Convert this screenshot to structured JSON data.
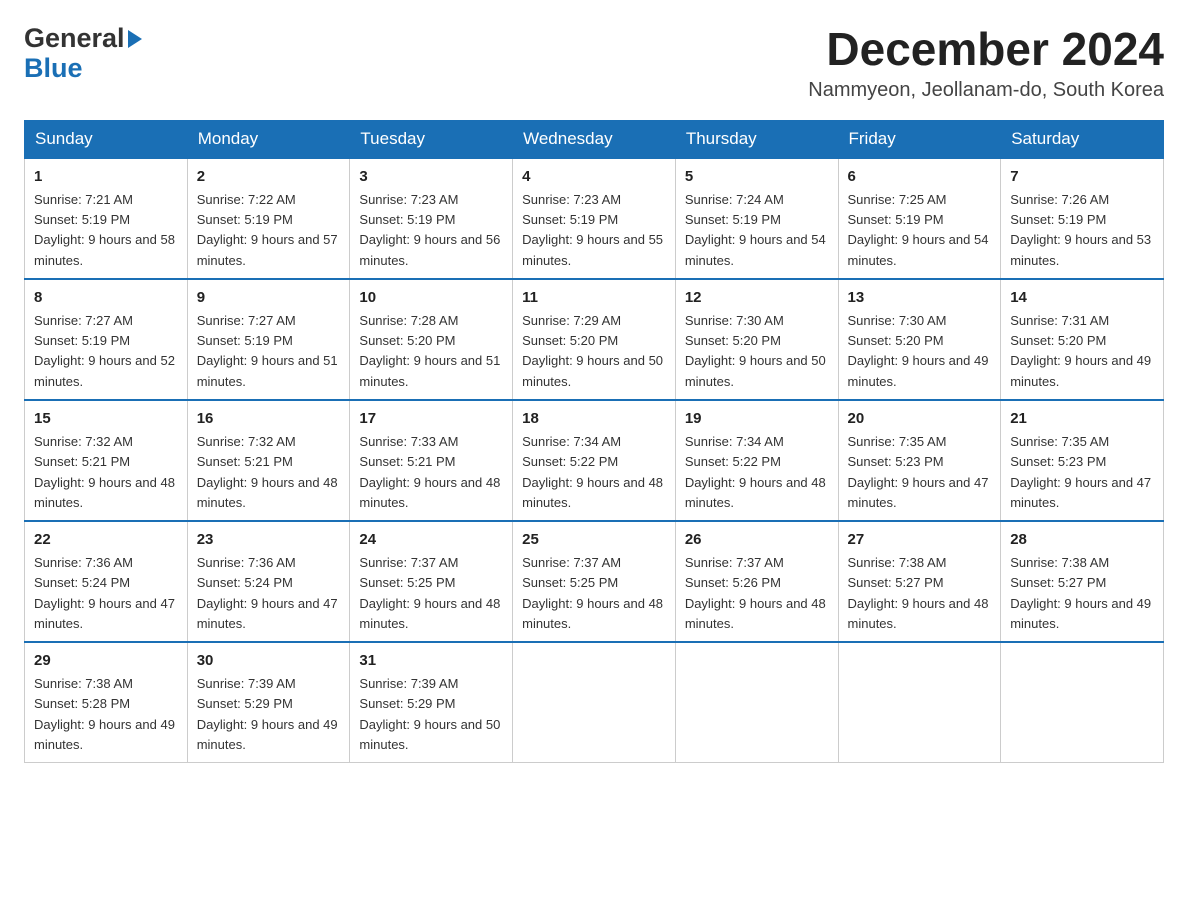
{
  "header": {
    "logo_general": "General",
    "logo_blue": "Blue",
    "title": "December 2024",
    "subtitle": "Nammyeon, Jeollanam-do, South Korea"
  },
  "calendar": {
    "days_of_week": [
      "Sunday",
      "Monday",
      "Tuesday",
      "Wednesday",
      "Thursday",
      "Friday",
      "Saturday"
    ],
    "weeks": [
      [
        {
          "day": "1",
          "sunrise": "7:21 AM",
          "sunset": "5:19 PM",
          "daylight": "9 hours and 58 minutes."
        },
        {
          "day": "2",
          "sunrise": "7:22 AM",
          "sunset": "5:19 PM",
          "daylight": "9 hours and 57 minutes."
        },
        {
          "day": "3",
          "sunrise": "7:23 AM",
          "sunset": "5:19 PM",
          "daylight": "9 hours and 56 minutes."
        },
        {
          "day": "4",
          "sunrise": "7:23 AM",
          "sunset": "5:19 PM",
          "daylight": "9 hours and 55 minutes."
        },
        {
          "day": "5",
          "sunrise": "7:24 AM",
          "sunset": "5:19 PM",
          "daylight": "9 hours and 54 minutes."
        },
        {
          "day": "6",
          "sunrise": "7:25 AM",
          "sunset": "5:19 PM",
          "daylight": "9 hours and 54 minutes."
        },
        {
          "day": "7",
          "sunrise": "7:26 AM",
          "sunset": "5:19 PM",
          "daylight": "9 hours and 53 minutes."
        }
      ],
      [
        {
          "day": "8",
          "sunrise": "7:27 AM",
          "sunset": "5:19 PM",
          "daylight": "9 hours and 52 minutes."
        },
        {
          "day": "9",
          "sunrise": "7:27 AM",
          "sunset": "5:19 PM",
          "daylight": "9 hours and 51 minutes."
        },
        {
          "day": "10",
          "sunrise": "7:28 AM",
          "sunset": "5:20 PM",
          "daylight": "9 hours and 51 minutes."
        },
        {
          "day": "11",
          "sunrise": "7:29 AM",
          "sunset": "5:20 PM",
          "daylight": "9 hours and 50 minutes."
        },
        {
          "day": "12",
          "sunrise": "7:30 AM",
          "sunset": "5:20 PM",
          "daylight": "9 hours and 50 minutes."
        },
        {
          "day": "13",
          "sunrise": "7:30 AM",
          "sunset": "5:20 PM",
          "daylight": "9 hours and 49 minutes."
        },
        {
          "day": "14",
          "sunrise": "7:31 AM",
          "sunset": "5:20 PM",
          "daylight": "9 hours and 49 minutes."
        }
      ],
      [
        {
          "day": "15",
          "sunrise": "7:32 AM",
          "sunset": "5:21 PM",
          "daylight": "9 hours and 48 minutes."
        },
        {
          "day": "16",
          "sunrise": "7:32 AM",
          "sunset": "5:21 PM",
          "daylight": "9 hours and 48 minutes."
        },
        {
          "day": "17",
          "sunrise": "7:33 AM",
          "sunset": "5:21 PM",
          "daylight": "9 hours and 48 minutes."
        },
        {
          "day": "18",
          "sunrise": "7:34 AM",
          "sunset": "5:22 PM",
          "daylight": "9 hours and 48 minutes."
        },
        {
          "day": "19",
          "sunrise": "7:34 AM",
          "sunset": "5:22 PM",
          "daylight": "9 hours and 48 minutes."
        },
        {
          "day": "20",
          "sunrise": "7:35 AM",
          "sunset": "5:23 PM",
          "daylight": "9 hours and 47 minutes."
        },
        {
          "day": "21",
          "sunrise": "7:35 AM",
          "sunset": "5:23 PM",
          "daylight": "9 hours and 47 minutes."
        }
      ],
      [
        {
          "day": "22",
          "sunrise": "7:36 AM",
          "sunset": "5:24 PM",
          "daylight": "9 hours and 47 minutes."
        },
        {
          "day": "23",
          "sunrise": "7:36 AM",
          "sunset": "5:24 PM",
          "daylight": "9 hours and 47 minutes."
        },
        {
          "day": "24",
          "sunrise": "7:37 AM",
          "sunset": "5:25 PM",
          "daylight": "9 hours and 48 minutes."
        },
        {
          "day": "25",
          "sunrise": "7:37 AM",
          "sunset": "5:25 PM",
          "daylight": "9 hours and 48 minutes."
        },
        {
          "day": "26",
          "sunrise": "7:37 AM",
          "sunset": "5:26 PM",
          "daylight": "9 hours and 48 minutes."
        },
        {
          "day": "27",
          "sunrise": "7:38 AM",
          "sunset": "5:27 PM",
          "daylight": "9 hours and 48 minutes."
        },
        {
          "day": "28",
          "sunrise": "7:38 AM",
          "sunset": "5:27 PM",
          "daylight": "9 hours and 49 minutes."
        }
      ],
      [
        {
          "day": "29",
          "sunrise": "7:38 AM",
          "sunset": "5:28 PM",
          "daylight": "9 hours and 49 minutes."
        },
        {
          "day": "30",
          "sunrise": "7:39 AM",
          "sunset": "5:29 PM",
          "daylight": "9 hours and 49 minutes."
        },
        {
          "day": "31",
          "sunrise": "7:39 AM",
          "sunset": "5:29 PM",
          "daylight": "9 hours and 50 minutes."
        },
        null,
        null,
        null,
        null
      ]
    ]
  }
}
